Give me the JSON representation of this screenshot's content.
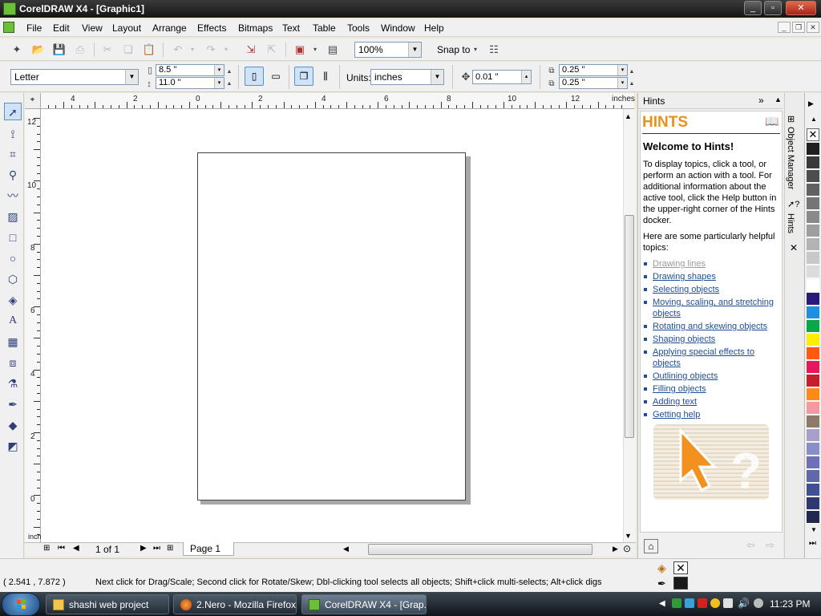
{
  "window": {
    "title": "CorelDRAW X4 - [Graphic1]"
  },
  "menu": [
    "File",
    "Edit",
    "View",
    "Layout",
    "Arrange",
    "Effects",
    "Bitmaps",
    "Text",
    "Table",
    "Tools",
    "Window",
    "Help"
  ],
  "toolbar": {
    "zoom": "100%",
    "snap_to": "Snap to"
  },
  "properties": {
    "paper": "Letter",
    "width": "8.5 \"",
    "height": "11.0 \"",
    "units_label": "Units:",
    "units": "inches",
    "nudge": "0.01 \"",
    "dup_x": "0.25 \"",
    "dup_y": "0.25 \""
  },
  "ruler": {
    "unit": "inches",
    "h_labels": [
      "4",
      "2",
      "0",
      "2",
      "4",
      "6",
      "8",
      "10",
      "12"
    ],
    "v_labels": [
      "12",
      "10",
      "8",
      "6",
      "4",
      "2",
      "0"
    ],
    "v_unit": "inches"
  },
  "page_nav": {
    "count": "1 of 1",
    "tab": "Page 1"
  },
  "docker": {
    "header": "Hints",
    "title": "HINTS",
    "heading": "Welcome to Hints!",
    "intro_lines": [
      "To display topics, click a tool, or",
      "perform an action with a tool. For",
      "additional information about the",
      "active tool, click the Help button in",
      "the upper-right corner of the Hints",
      "docker."
    ],
    "helpful_lines": [
      "Here are some particularly helpful",
      "topics:"
    ],
    "links": [
      {
        "lines": [
          "Drawing lines"
        ],
        "visited": true
      },
      {
        "lines": [
          "Drawing shapes"
        ],
        "visited": false
      },
      {
        "lines": [
          "Selecting objects"
        ],
        "visited": false
      },
      {
        "lines": [
          "Moving, scaling, and stretching",
          "objects"
        ],
        "visited": false
      },
      {
        "lines": [
          "Rotating and skewing objects"
        ],
        "visited": false
      },
      {
        "lines": [
          "Shaping objects"
        ],
        "visited": false
      },
      {
        "lines": [
          "Applying special effects to",
          "objects"
        ],
        "visited": false
      },
      {
        "lines": [
          "Outlining objects"
        ],
        "visited": false
      },
      {
        "lines": [
          "Filling objects"
        ],
        "visited": false
      },
      {
        "lines": [
          "Adding text"
        ],
        "visited": false
      },
      {
        "lines": [
          "Getting help"
        ],
        "visited": false
      }
    ],
    "tabs": [
      "Object Manager",
      "Hints"
    ]
  },
  "palette": [
    "#202020",
    "#3a3a3a",
    "#4d4d4d",
    "#616161",
    "#757575",
    "#8a8a8a",
    "#9e9e9e",
    "#b3b3b3",
    "#c8c8c8",
    "#dcdcdc",
    "#ffffff",
    "#2a1a7a",
    "#1e90e0",
    "#0aa64a",
    "#ffee00",
    "#ff5a10",
    "#e4185a",
    "#c81d2a",
    "#ff8a1a",
    "#f39aa0",
    "#8c7a6a",
    "#a8a0c8",
    "#8890c8",
    "#7070b8",
    "#6068a8",
    "#405090",
    "#303870",
    "#202850"
  ],
  "status": {
    "coords": "( 2.541 , 7.872 )",
    "message": "Next click for Drag/Scale; Second click for Rotate/Skew; Dbl-clicking tool selects all objects; Shift+click multi-selects; Alt+click digs"
  },
  "taskbar": {
    "items": [
      {
        "label": "shashi web project",
        "active": false
      },
      {
        "label": "2.Nero - Mozilla Firefox",
        "active": false
      },
      {
        "label": "CorelDRAW X4 - [Grap...",
        "active": true
      }
    ],
    "clock": "11:23 PM"
  }
}
